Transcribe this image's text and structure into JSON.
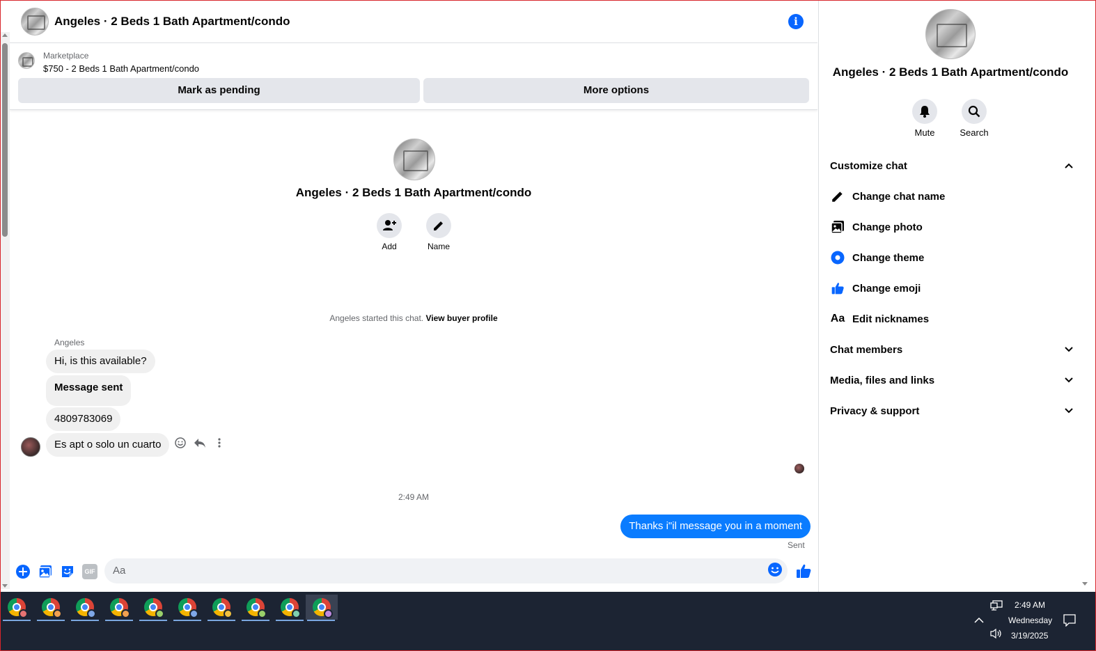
{
  "header": {
    "title": "Angeles · 2 Beds 1 Bath Apartment/condo",
    "info_glyph": "i"
  },
  "marketplace": {
    "label": "Marketplace",
    "listing": "$750 - 2 Beds 1 Bath Apartment/condo",
    "pending_label": "Mark as pending",
    "more_label": "More options"
  },
  "intro": {
    "title": "Angeles · 2 Beds 1 Bath Apartment/condo",
    "add_label": "Add",
    "name_label": "Name"
  },
  "started": {
    "text": "Angeles started this chat.",
    "link": "View buyer profile"
  },
  "messages": {
    "sender": "Angeles",
    "m1": "Hi, is this available?",
    "m2": "Message sent",
    "m3": "4809783069",
    "m4": "Es apt o solo un cuarto",
    "time": "2:49 AM",
    "out1": "Thanks i\"il message you in a moment",
    "status": "Sent"
  },
  "composer": {
    "placeholder": "Aa",
    "gif_label": "GIF"
  },
  "info_panel": {
    "title": "Angeles · 2 Beds 1 Bath Apartment/condo",
    "mute_label": "Mute",
    "search_label": "Search",
    "customize": "Customize chat",
    "items": [
      {
        "label": "Change chat name",
        "icon": "pencil-icon"
      },
      {
        "label": "Change photo",
        "icon": "photo-icon"
      },
      {
        "label": "Change theme",
        "icon": "theme-icon"
      },
      {
        "label": "Change emoji",
        "icon": "thumbs-up-icon"
      },
      {
        "label": "Edit nicknames",
        "icon": "text-icon",
        "glyph": "Aa"
      }
    ],
    "chat_members": "Chat members",
    "media": "Media, files and links",
    "privacy": "Privacy & support"
  },
  "taskbar": {
    "time": "2:49 AM",
    "day": "Wednesday",
    "date": "3/19/2025"
  },
  "colors": {
    "accent": "#0866ff",
    "outgoing_bubble": "#0a7cff",
    "taskbar": "#1c2433"
  }
}
